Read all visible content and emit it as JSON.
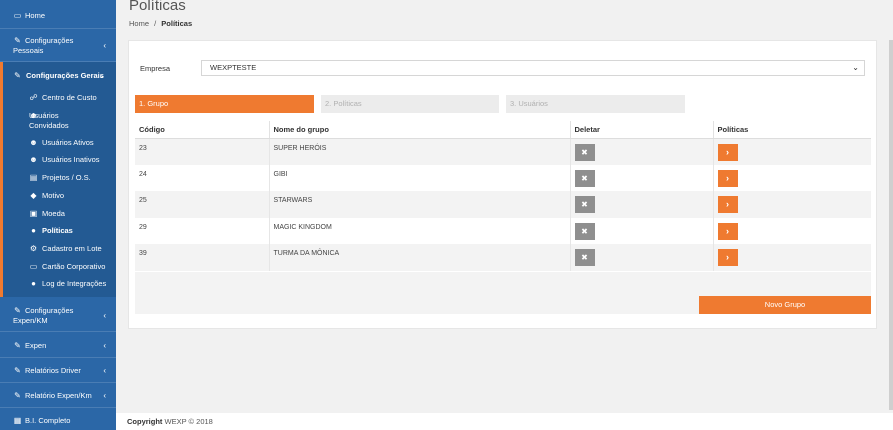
{
  "header": {
    "title": "Políticas"
  },
  "breadcrumb": {
    "home": "Home",
    "sep": "/",
    "current": "Políticas"
  },
  "sidebar": {
    "home": "Home",
    "config_pessoais_1": "Configurações",
    "config_pessoais_2": "Pessoais",
    "config_gerais": "Configurações Gerais",
    "sub": {
      "centro_custo": "Centro de Custo",
      "usuarios_convidados_1": "Usuários",
      "usuarios_convidados_2": "Convidados",
      "usuarios_ativos": "Usuários Ativos",
      "usuarios_inativos": "Usuários Inativos",
      "projetos": "Projetos / O.S.",
      "motivo": "Motivo",
      "moeda": "Moeda",
      "politicas": "Políticas",
      "cadastro_lote": "Cadastro em Lote",
      "cartao": "Cartão Corporativo",
      "log": "Log de Integrações"
    },
    "config_expen_1": "Configurações",
    "config_expen_2": "Expen/KM",
    "expen": "Expen",
    "relatorios_driver": "Relatórios Driver",
    "relatorio_expen": "Relatório Expen/Km",
    "bi": "B.I. Completo"
  },
  "form": {
    "empresa_label": "Empresa",
    "empresa_value": "WEXPTESTE"
  },
  "steps": [
    "1. Grupo",
    "2. Políticas",
    "3. Usuários"
  ],
  "table": {
    "headers": [
      "Código",
      "Nome do grupo",
      "Deletar",
      "Políticas"
    ],
    "rows": [
      {
        "codigo": "23",
        "nome": "SUPER HERÓIS"
      },
      {
        "codigo": "24",
        "nome": "GIBI"
      },
      {
        "codigo": "25",
        "nome": "STARWARS"
      },
      {
        "codigo": "29",
        "nome": "MAGIC KINGDOM"
      },
      {
        "codigo": "39",
        "nome": "TURMA DA MÔNICA"
      }
    ]
  },
  "actions": {
    "novo_grupo": "Novo Grupo",
    "delete_glyph": "✖",
    "open_glyph": "›"
  },
  "footer": {
    "copyright_label": "Copyright",
    "copyright_text": "WEXP © 2018"
  },
  "colors": {
    "sidebar": "#2b67a7",
    "accent": "#ef7a30"
  }
}
